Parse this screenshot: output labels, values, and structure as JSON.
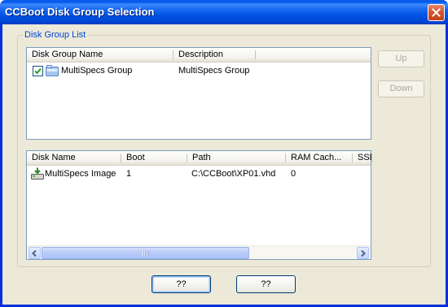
{
  "window": {
    "title": "CCBoot Disk Group Selection",
    "close_icon": "close-icon"
  },
  "group_box": {
    "label": "Disk Group List"
  },
  "disk_group_list": {
    "columns": [
      "Disk Group Name",
      "Description"
    ],
    "rows": [
      {
        "checked": true,
        "icon": "disk-group-icon",
        "name": "MultiSpecs Group",
        "description": "MultiSpecs Group"
      }
    ]
  },
  "disk_list": {
    "columns": [
      "Disk Name",
      "Boot",
      "Path",
      "RAM Cach...",
      "SSD"
    ],
    "rows": [
      {
        "icon": "disk-icon",
        "name": "MultiSpecs Image",
        "boot": "1",
        "path": "C:\\CCBoot\\XP01.vhd",
        "ram_cache": "0"
      }
    ]
  },
  "buttons": {
    "up": "Up",
    "down": "Down",
    "ok": "??",
    "cancel": "??"
  },
  "colors": {
    "title_bar": "#0058ee",
    "group_label": "#0046d5",
    "client_bg": "#ece9d8"
  }
}
